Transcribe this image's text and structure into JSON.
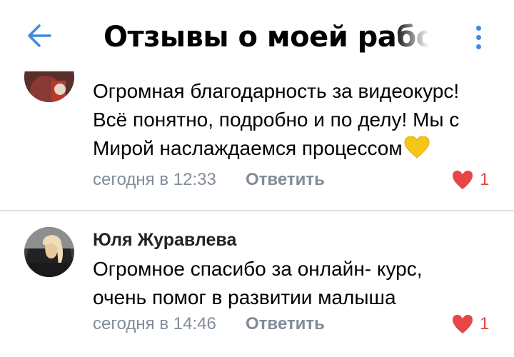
{
  "header": {
    "title": "Отзывы о моей работе",
    "back_icon": "arrow-left-icon",
    "menu_icon": "more-vertical-icon"
  },
  "comments": [
    {
      "author": "",
      "text": "Огромная благодарность за видеокурс! Всё понятно, подробно и по делу! Мы с Мирой наслаждаемся процессом",
      "emoji": "yellow-heart-icon",
      "time": "сегодня в 12:33",
      "reply_label": "Ответить",
      "likes": "1"
    },
    {
      "author": "Юля Журавлева",
      "text": "Огромное спасибо за онлайн- курс, очень помог в развитии малыша",
      "time": "сегодня в 14:46",
      "reply_label": "Ответить",
      "likes": "1"
    }
  ],
  "colors": {
    "accent": "#3f8ae0",
    "like": "#e64646",
    "meta": "#818c99",
    "divider": "#dce1e6"
  }
}
